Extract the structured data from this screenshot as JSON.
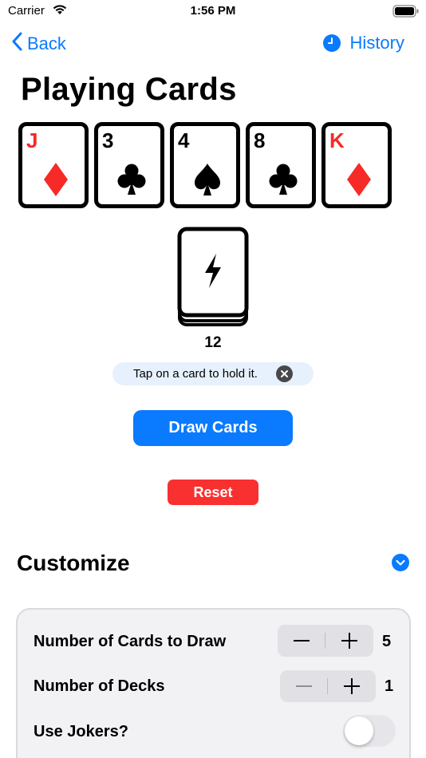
{
  "status_bar": {
    "carrier": "Carrier",
    "time": "1:56 PM"
  },
  "nav": {
    "back_label": "Back",
    "history_label": "History"
  },
  "page_title": "Playing Cards",
  "cards": [
    {
      "rank": "J",
      "suit": "diamond",
      "color": "#f62a27"
    },
    {
      "rank": "3",
      "suit": "club",
      "color": "#000000"
    },
    {
      "rank": "4",
      "suit": "spade",
      "color": "#000000"
    },
    {
      "rank": "8",
      "suit": "club",
      "color": "#000000"
    },
    {
      "rank": "K",
      "suit": "diamond",
      "color": "#f62a27"
    }
  ],
  "deck": {
    "icon": "lightning-bolt-icon",
    "remaining": "12"
  },
  "hint": {
    "text": "Tap on a card to hold it."
  },
  "actions": {
    "draw_label": "Draw Cards",
    "reset_label": "Reset"
  },
  "customize": {
    "title": "Customize",
    "settings": {
      "cards_to_draw": {
        "label": "Number of Cards to Draw",
        "value": "5"
      },
      "decks": {
        "label": "Number of Decks",
        "value": "1"
      },
      "jokers": {
        "label": "Use Jokers?",
        "enabled": false
      }
    }
  },
  "colors": {
    "accent": "#0a7aff",
    "destructive": "#f8302f",
    "card_red": "#f62a27"
  }
}
